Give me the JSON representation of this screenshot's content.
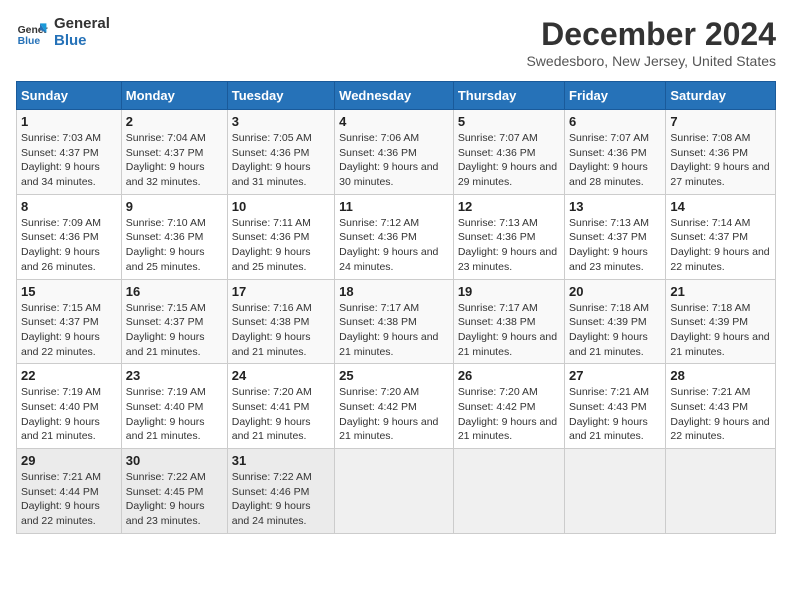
{
  "logo": {
    "line1": "General",
    "line2": "Blue"
  },
  "title": "December 2024",
  "subtitle": "Swedesboro, New Jersey, United States",
  "days_header": [
    "Sunday",
    "Monday",
    "Tuesday",
    "Wednesday",
    "Thursday",
    "Friday",
    "Saturday"
  ],
  "weeks": [
    [
      {
        "day": "1",
        "sunrise": "7:03 AM",
        "sunset": "4:37 PM",
        "daylight": "9 hours and 34 minutes."
      },
      {
        "day": "2",
        "sunrise": "7:04 AM",
        "sunset": "4:37 PM",
        "daylight": "9 hours and 32 minutes."
      },
      {
        "day": "3",
        "sunrise": "7:05 AM",
        "sunset": "4:36 PM",
        "daylight": "9 hours and 31 minutes."
      },
      {
        "day": "4",
        "sunrise": "7:06 AM",
        "sunset": "4:36 PM",
        "daylight": "9 hours and 30 minutes."
      },
      {
        "day": "5",
        "sunrise": "7:07 AM",
        "sunset": "4:36 PM",
        "daylight": "9 hours and 29 minutes."
      },
      {
        "day": "6",
        "sunrise": "7:07 AM",
        "sunset": "4:36 PM",
        "daylight": "9 hours and 28 minutes."
      },
      {
        "day": "7",
        "sunrise": "7:08 AM",
        "sunset": "4:36 PM",
        "daylight": "9 hours and 27 minutes."
      }
    ],
    [
      {
        "day": "8",
        "sunrise": "7:09 AM",
        "sunset": "4:36 PM",
        "daylight": "9 hours and 26 minutes."
      },
      {
        "day": "9",
        "sunrise": "7:10 AM",
        "sunset": "4:36 PM",
        "daylight": "9 hours and 25 minutes."
      },
      {
        "day": "10",
        "sunrise": "7:11 AM",
        "sunset": "4:36 PM",
        "daylight": "9 hours and 25 minutes."
      },
      {
        "day": "11",
        "sunrise": "7:12 AM",
        "sunset": "4:36 PM",
        "daylight": "9 hours and 24 minutes."
      },
      {
        "day": "12",
        "sunrise": "7:13 AM",
        "sunset": "4:36 PM",
        "daylight": "9 hours and 23 minutes."
      },
      {
        "day": "13",
        "sunrise": "7:13 AM",
        "sunset": "4:37 PM",
        "daylight": "9 hours and 23 minutes."
      },
      {
        "day": "14",
        "sunrise": "7:14 AM",
        "sunset": "4:37 PM",
        "daylight": "9 hours and 22 minutes."
      }
    ],
    [
      {
        "day": "15",
        "sunrise": "7:15 AM",
        "sunset": "4:37 PM",
        "daylight": "9 hours and 22 minutes."
      },
      {
        "day": "16",
        "sunrise": "7:15 AM",
        "sunset": "4:37 PM",
        "daylight": "9 hours and 21 minutes."
      },
      {
        "day": "17",
        "sunrise": "7:16 AM",
        "sunset": "4:38 PM",
        "daylight": "9 hours and 21 minutes."
      },
      {
        "day": "18",
        "sunrise": "7:17 AM",
        "sunset": "4:38 PM",
        "daylight": "9 hours and 21 minutes."
      },
      {
        "day": "19",
        "sunrise": "7:17 AM",
        "sunset": "4:38 PM",
        "daylight": "9 hours and 21 minutes."
      },
      {
        "day": "20",
        "sunrise": "7:18 AM",
        "sunset": "4:39 PM",
        "daylight": "9 hours and 21 minutes."
      },
      {
        "day": "21",
        "sunrise": "7:18 AM",
        "sunset": "4:39 PM",
        "daylight": "9 hours and 21 minutes."
      }
    ],
    [
      {
        "day": "22",
        "sunrise": "7:19 AM",
        "sunset": "4:40 PM",
        "daylight": "9 hours and 21 minutes."
      },
      {
        "day": "23",
        "sunrise": "7:19 AM",
        "sunset": "4:40 PM",
        "daylight": "9 hours and 21 minutes."
      },
      {
        "day": "24",
        "sunrise": "7:20 AM",
        "sunset": "4:41 PM",
        "daylight": "9 hours and 21 minutes."
      },
      {
        "day": "25",
        "sunrise": "7:20 AM",
        "sunset": "4:42 PM",
        "daylight": "9 hours and 21 minutes."
      },
      {
        "day": "26",
        "sunrise": "7:20 AM",
        "sunset": "4:42 PM",
        "daylight": "9 hours and 21 minutes."
      },
      {
        "day": "27",
        "sunrise": "7:21 AM",
        "sunset": "4:43 PM",
        "daylight": "9 hours and 21 minutes."
      },
      {
        "day": "28",
        "sunrise": "7:21 AM",
        "sunset": "4:43 PM",
        "daylight": "9 hours and 22 minutes."
      }
    ],
    [
      {
        "day": "29",
        "sunrise": "7:21 AM",
        "sunset": "4:44 PM",
        "daylight": "9 hours and 22 minutes."
      },
      {
        "day": "30",
        "sunrise": "7:22 AM",
        "sunset": "4:45 PM",
        "daylight": "9 hours and 23 minutes."
      },
      {
        "day": "31",
        "sunrise": "7:22 AM",
        "sunset": "4:46 PM",
        "daylight": "9 hours and 24 minutes."
      },
      null,
      null,
      null,
      null
    ]
  ],
  "labels": {
    "sunrise": "Sunrise:",
    "sunset": "Sunset:",
    "daylight": "Daylight:"
  }
}
